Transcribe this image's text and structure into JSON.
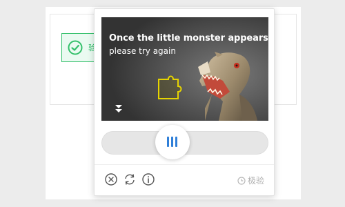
{
  "captcha": {
    "title": "Once the little monster appears",
    "subtitle": "please try again"
  },
  "background_widget": {
    "status_text": "验"
  },
  "footer": {
    "close_icon": "close-circle-icon",
    "refresh_icon": "refresh-icon",
    "info_icon": "info-icon",
    "brand_label": "极验"
  },
  "slider": {
    "handle_icon": "grip-icon",
    "position": 0
  },
  "colors": {
    "accent": "#2f7fd8",
    "success": "#33c06a",
    "puzzle_outline": "#e6d400"
  }
}
